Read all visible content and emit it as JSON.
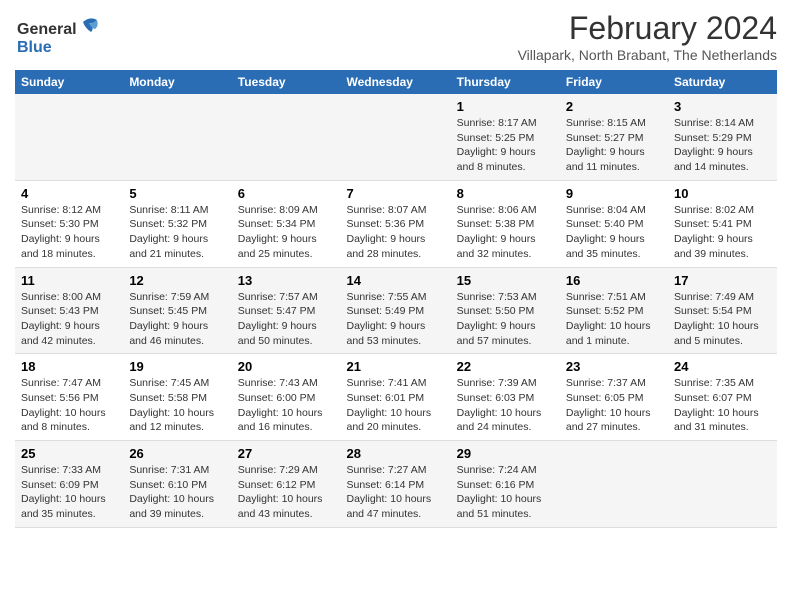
{
  "logo": {
    "line1": "General",
    "line2": "Blue"
  },
  "title": "February 2024",
  "subtitle": "Villapark, North Brabant, The Netherlands",
  "headers": [
    "Sunday",
    "Monday",
    "Tuesday",
    "Wednesday",
    "Thursday",
    "Friday",
    "Saturday"
  ],
  "weeks": [
    [
      {
        "day": "",
        "text": ""
      },
      {
        "day": "",
        "text": ""
      },
      {
        "day": "",
        "text": ""
      },
      {
        "day": "",
        "text": ""
      },
      {
        "day": "1",
        "text": "Sunrise: 8:17 AM\nSunset: 5:25 PM\nDaylight: 9 hours\nand 8 minutes."
      },
      {
        "day": "2",
        "text": "Sunrise: 8:15 AM\nSunset: 5:27 PM\nDaylight: 9 hours\nand 11 minutes."
      },
      {
        "day": "3",
        "text": "Sunrise: 8:14 AM\nSunset: 5:29 PM\nDaylight: 9 hours\nand 14 minutes."
      }
    ],
    [
      {
        "day": "4",
        "text": "Sunrise: 8:12 AM\nSunset: 5:30 PM\nDaylight: 9 hours\nand 18 minutes."
      },
      {
        "day": "5",
        "text": "Sunrise: 8:11 AM\nSunset: 5:32 PM\nDaylight: 9 hours\nand 21 minutes."
      },
      {
        "day": "6",
        "text": "Sunrise: 8:09 AM\nSunset: 5:34 PM\nDaylight: 9 hours\nand 25 minutes."
      },
      {
        "day": "7",
        "text": "Sunrise: 8:07 AM\nSunset: 5:36 PM\nDaylight: 9 hours\nand 28 minutes."
      },
      {
        "day": "8",
        "text": "Sunrise: 8:06 AM\nSunset: 5:38 PM\nDaylight: 9 hours\nand 32 minutes."
      },
      {
        "day": "9",
        "text": "Sunrise: 8:04 AM\nSunset: 5:40 PM\nDaylight: 9 hours\nand 35 minutes."
      },
      {
        "day": "10",
        "text": "Sunrise: 8:02 AM\nSunset: 5:41 PM\nDaylight: 9 hours\nand 39 minutes."
      }
    ],
    [
      {
        "day": "11",
        "text": "Sunrise: 8:00 AM\nSunset: 5:43 PM\nDaylight: 9 hours\nand 42 minutes."
      },
      {
        "day": "12",
        "text": "Sunrise: 7:59 AM\nSunset: 5:45 PM\nDaylight: 9 hours\nand 46 minutes."
      },
      {
        "day": "13",
        "text": "Sunrise: 7:57 AM\nSunset: 5:47 PM\nDaylight: 9 hours\nand 50 minutes."
      },
      {
        "day": "14",
        "text": "Sunrise: 7:55 AM\nSunset: 5:49 PM\nDaylight: 9 hours\nand 53 minutes."
      },
      {
        "day": "15",
        "text": "Sunrise: 7:53 AM\nSunset: 5:50 PM\nDaylight: 9 hours\nand 57 minutes."
      },
      {
        "day": "16",
        "text": "Sunrise: 7:51 AM\nSunset: 5:52 PM\nDaylight: 10 hours\nand 1 minute."
      },
      {
        "day": "17",
        "text": "Sunrise: 7:49 AM\nSunset: 5:54 PM\nDaylight: 10 hours\nand 5 minutes."
      }
    ],
    [
      {
        "day": "18",
        "text": "Sunrise: 7:47 AM\nSunset: 5:56 PM\nDaylight: 10 hours\nand 8 minutes."
      },
      {
        "day": "19",
        "text": "Sunrise: 7:45 AM\nSunset: 5:58 PM\nDaylight: 10 hours\nand 12 minutes."
      },
      {
        "day": "20",
        "text": "Sunrise: 7:43 AM\nSunset: 6:00 PM\nDaylight: 10 hours\nand 16 minutes."
      },
      {
        "day": "21",
        "text": "Sunrise: 7:41 AM\nSunset: 6:01 PM\nDaylight: 10 hours\nand 20 minutes."
      },
      {
        "day": "22",
        "text": "Sunrise: 7:39 AM\nSunset: 6:03 PM\nDaylight: 10 hours\nand 24 minutes."
      },
      {
        "day": "23",
        "text": "Sunrise: 7:37 AM\nSunset: 6:05 PM\nDaylight: 10 hours\nand 27 minutes."
      },
      {
        "day": "24",
        "text": "Sunrise: 7:35 AM\nSunset: 6:07 PM\nDaylight: 10 hours\nand 31 minutes."
      }
    ],
    [
      {
        "day": "25",
        "text": "Sunrise: 7:33 AM\nSunset: 6:09 PM\nDaylight: 10 hours\nand 35 minutes."
      },
      {
        "day": "26",
        "text": "Sunrise: 7:31 AM\nSunset: 6:10 PM\nDaylight: 10 hours\nand 39 minutes."
      },
      {
        "day": "27",
        "text": "Sunrise: 7:29 AM\nSunset: 6:12 PM\nDaylight: 10 hours\nand 43 minutes."
      },
      {
        "day": "28",
        "text": "Sunrise: 7:27 AM\nSunset: 6:14 PM\nDaylight: 10 hours\nand 47 minutes."
      },
      {
        "day": "29",
        "text": "Sunrise: 7:24 AM\nSunset: 6:16 PM\nDaylight: 10 hours\nand 51 minutes."
      },
      {
        "day": "",
        "text": ""
      },
      {
        "day": "",
        "text": ""
      }
    ]
  ]
}
